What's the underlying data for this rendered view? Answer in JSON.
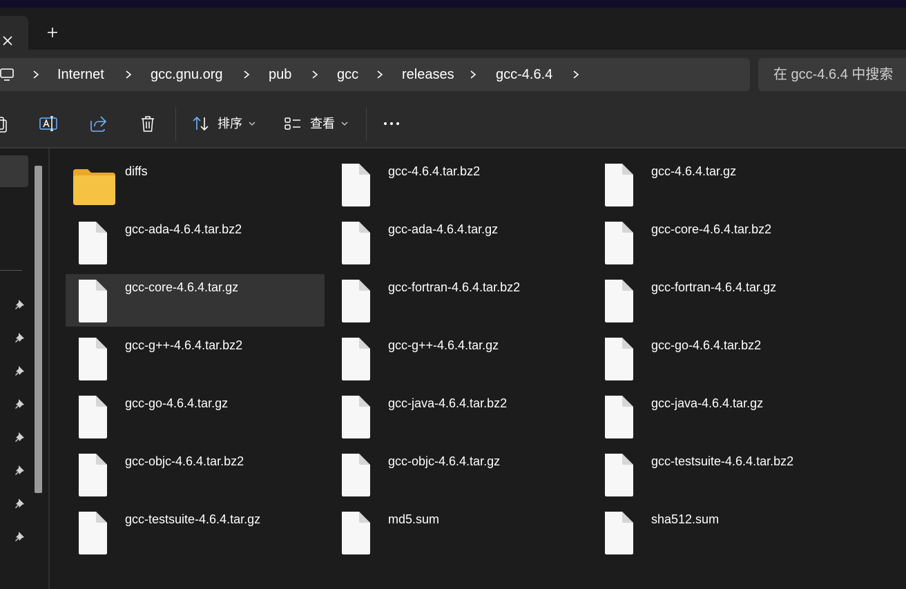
{
  "tabs": {
    "close_icon": "close-icon",
    "new_tab_icon": "plus-icon"
  },
  "address_bar": {
    "root_icon": "computer-icon",
    "breadcrumbs": [
      "Internet",
      "gcc.gnu.org",
      "pub",
      "gcc",
      "releases",
      "gcc-4.6.4"
    ]
  },
  "search": {
    "placeholder": "在 gcc-4.6.4 中搜索"
  },
  "toolbar": {
    "icons": [
      "copy-icon",
      "rename-icon",
      "share-icon",
      "delete-icon"
    ],
    "sort_label": "排序",
    "view_label": "查看",
    "more_icon": "more-icon"
  },
  "files": [
    {
      "name": "diffs",
      "type": "folder"
    },
    {
      "name": "gcc-4.6.4.tar.bz2",
      "type": "file"
    },
    {
      "name": "gcc-4.6.4.tar.gz",
      "type": "file"
    },
    {
      "name": "gcc-ada-4.6.4.tar.bz2",
      "type": "file"
    },
    {
      "name": "gcc-ada-4.6.4.tar.gz",
      "type": "file"
    },
    {
      "name": "gcc-core-4.6.4.tar.bz2",
      "type": "file"
    },
    {
      "name": "gcc-core-4.6.4.tar.gz",
      "type": "file",
      "selected": true
    },
    {
      "name": "gcc-fortran-4.6.4.tar.bz2",
      "type": "file"
    },
    {
      "name": "gcc-fortran-4.6.4.tar.gz",
      "type": "file"
    },
    {
      "name": "gcc-g++-4.6.4.tar.bz2",
      "type": "file"
    },
    {
      "name": "gcc-g++-4.6.4.tar.gz",
      "type": "file"
    },
    {
      "name": "gcc-go-4.6.4.tar.bz2",
      "type": "file"
    },
    {
      "name": "gcc-go-4.6.4.tar.gz",
      "type": "file"
    },
    {
      "name": "gcc-java-4.6.4.tar.bz2",
      "type": "file"
    },
    {
      "name": "gcc-java-4.6.4.tar.gz",
      "type": "file"
    },
    {
      "name": "gcc-objc-4.6.4.tar.bz2",
      "type": "file"
    },
    {
      "name": "gcc-objc-4.6.4.tar.gz",
      "type": "file"
    },
    {
      "name": "gcc-testsuite-4.6.4.tar.bz2",
      "type": "file"
    },
    {
      "name": "gcc-testsuite-4.6.4.tar.gz",
      "type": "file"
    },
    {
      "name": "md5.sum",
      "type": "file"
    },
    {
      "name": "sha512.sum",
      "type": "file"
    }
  ],
  "colors": {
    "folder": "#f5c244",
    "file": "#f7f7f7",
    "selected": "#343434"
  }
}
